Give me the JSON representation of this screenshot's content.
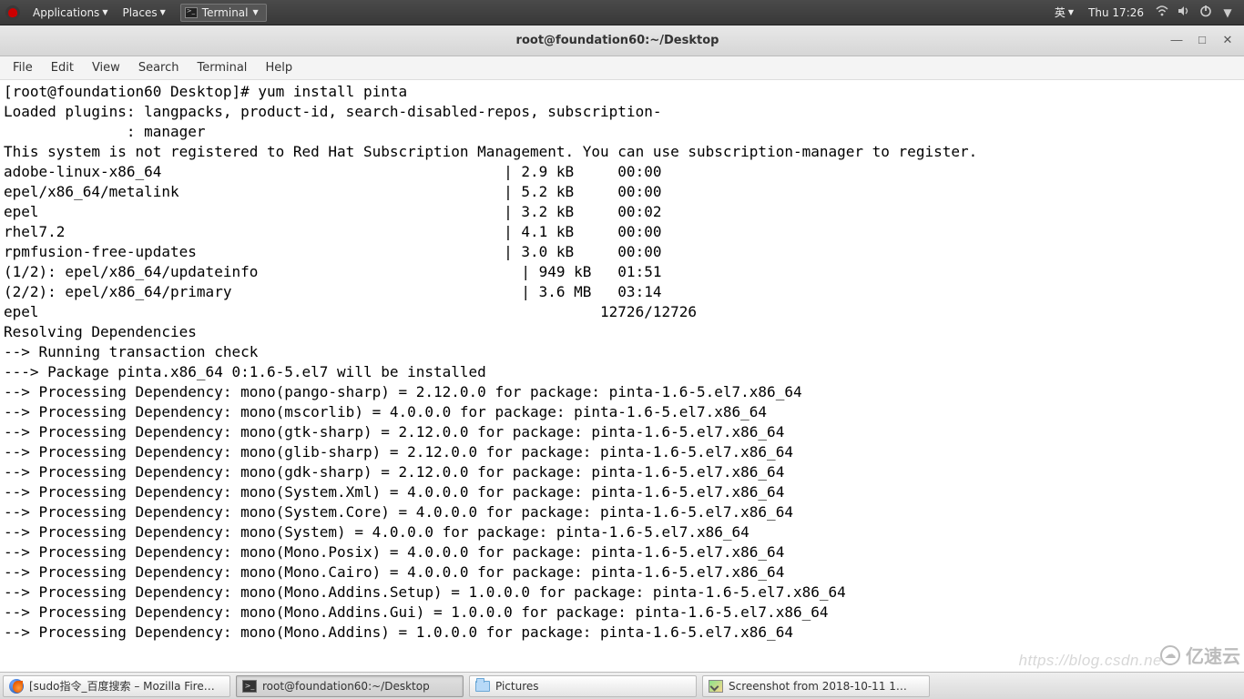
{
  "top_panel": {
    "applications": "Applications",
    "places": "Places",
    "terminal": "Terminal",
    "ime": "英",
    "clock": "Thu 17:26"
  },
  "window": {
    "title": "root@foundation60:~/Desktop",
    "menubar": [
      "File",
      "Edit",
      "View",
      "Search",
      "Terminal",
      "Help"
    ]
  },
  "terminal": {
    "prompt": "[root@foundation60 Desktop]# ",
    "cmd": "yum install pinta",
    "body_lines": [
      "Loaded plugins: langpacks, product-id, search-disabled-repos, subscription-",
      "              : manager",
      "This system is not registered to Red Hat Subscription Management. You can use subscription-manager to register.",
      "adobe-linux-x86_64                                       | 2.9 kB     00:00",
      "epel/x86_64/metalink                                     | 5.2 kB     00:00",
      "epel                                                     | 3.2 kB     00:02",
      "rhel7.2                                                  | 4.1 kB     00:00",
      "rpmfusion-free-updates                                   | 3.0 kB     00:00",
      "(1/2): epel/x86_64/updateinfo                              | 949 kB   01:51",
      "(2/2): epel/x86_64/primary                                 | 3.6 MB   03:14",
      "epel                                                                12726/12726",
      "Resolving Dependencies",
      "--> Running transaction check",
      "---> Package pinta.x86_64 0:1.6-5.el7 will be installed",
      "--> Processing Dependency: mono(pango-sharp) = 2.12.0.0 for package: pinta-1.6-5.el7.x86_64",
      "--> Processing Dependency: mono(mscorlib) = 4.0.0.0 for package: pinta-1.6-5.el7.x86_64",
      "--> Processing Dependency: mono(gtk-sharp) = 2.12.0.0 for package: pinta-1.6-5.el7.x86_64",
      "--> Processing Dependency: mono(glib-sharp) = 2.12.0.0 for package: pinta-1.6-5.el7.x86_64",
      "--> Processing Dependency: mono(gdk-sharp) = 2.12.0.0 for package: pinta-1.6-5.el7.x86_64",
      "--> Processing Dependency: mono(System.Xml) = 4.0.0.0 for package: pinta-1.6-5.el7.x86_64",
      "--> Processing Dependency: mono(System.Core) = 4.0.0.0 for package: pinta-1.6-5.el7.x86_64",
      "--> Processing Dependency: mono(System) = 4.0.0.0 for package: pinta-1.6-5.el7.x86_64",
      "--> Processing Dependency: mono(Mono.Posix) = 4.0.0.0 for package: pinta-1.6-5.el7.x86_64",
      "--> Processing Dependency: mono(Mono.Cairo) = 4.0.0.0 for package: pinta-1.6-5.el7.x86_64",
      "--> Processing Dependency: mono(Mono.Addins.Setup) = 1.0.0.0 for package: pinta-1.6-5.el7.x86_64",
      "--> Processing Dependency: mono(Mono.Addins.Gui) = 1.0.0.0 for package: pinta-1.6-5.el7.x86_64",
      "--> Processing Dependency: mono(Mono.Addins) = 1.0.0.0 for package: pinta-1.6-5.el7.x86_64"
    ]
  },
  "taskbar": {
    "firefox": "[sudo指令_百度搜索 – Mozilla Fire…",
    "terminal": "root@foundation60:~/Desktop",
    "pictures": "Pictures",
    "screenshot": "Screenshot from 2018-10-11 1…"
  },
  "watermarks": {
    "blog": "https://blog.csdn.ne",
    "site": "亿速云"
  }
}
